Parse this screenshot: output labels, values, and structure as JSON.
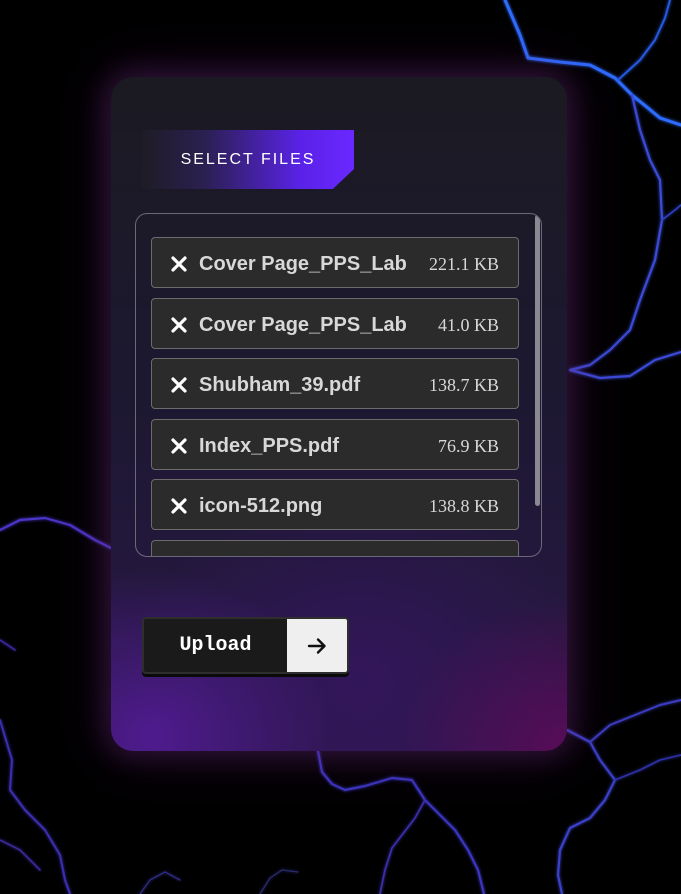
{
  "select_button": {
    "label": "SELECT FILES"
  },
  "files": [
    {
      "name": "Cover Page_PPS_Lab File",
      "size": "221.1 KB",
      "remove_icon": "close-icon"
    },
    {
      "name": "Cover Page_PPS_Lab File",
      "size": "41.0 KB",
      "remove_icon": "close-icon"
    },
    {
      "name": "Shubham_39.pdf",
      "size": "138.7 KB",
      "remove_icon": "close-icon"
    },
    {
      "name": "Index_PPS.pdf",
      "size": "76.9 KB",
      "remove_icon": "close-icon"
    },
    {
      "name": "icon-512.png",
      "size": "138.8 KB",
      "remove_icon": "close-icon"
    },
    {
      "name": "",
      "size": "",
      "remove_icon": "close-icon"
    }
  ],
  "upload_button": {
    "label": "Upload",
    "icon": "arrow-right-icon"
  },
  "colors": {
    "background": "#000000",
    "accent_purple": "#6a28ff",
    "lightning_blue": "#2f6cff",
    "file_row_bg": "#2b2b2b",
    "text": "#d8d8d8"
  }
}
